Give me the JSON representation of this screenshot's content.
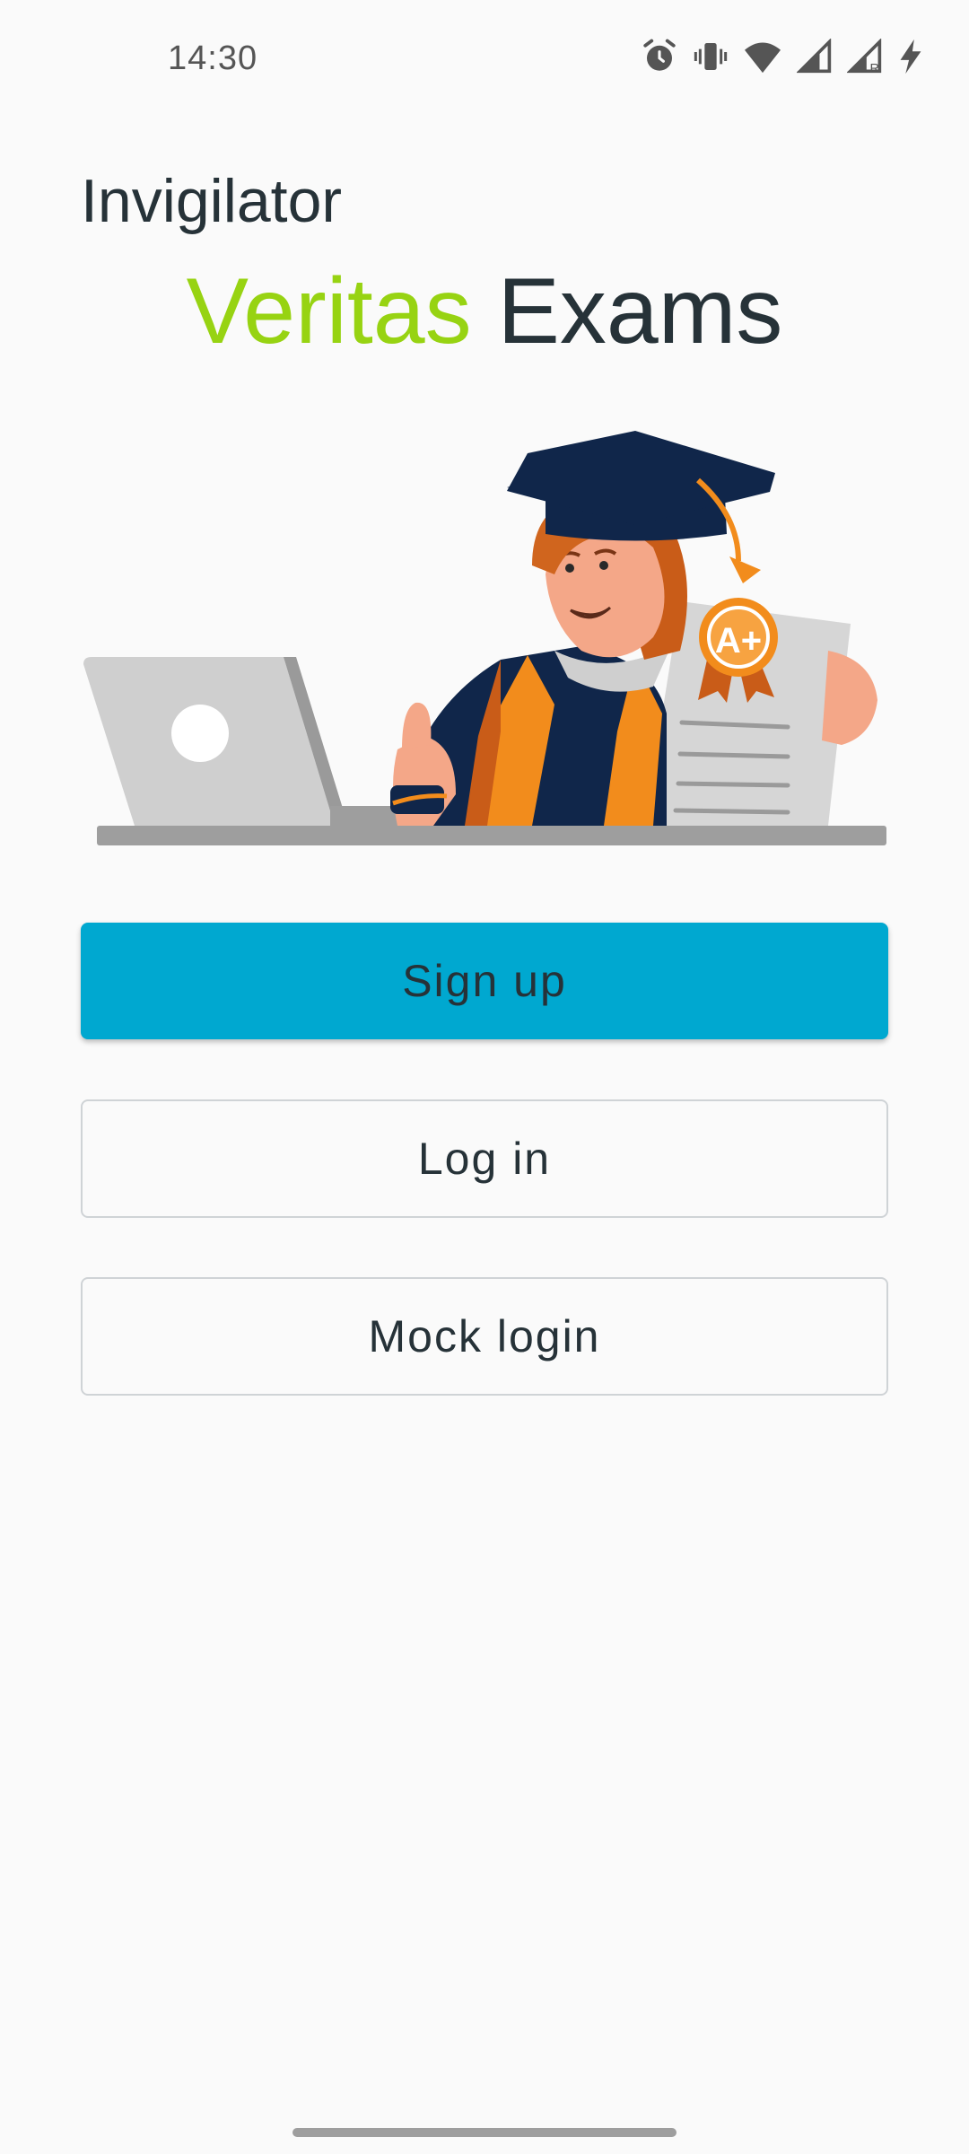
{
  "status_bar": {
    "time": "14:30",
    "icons": [
      "alarm-icon",
      "vibrate-icon",
      "wifi-icon",
      "signal-icon",
      "signal-roaming-icon",
      "charging-icon"
    ]
  },
  "header": {
    "role_label": "Invigilator",
    "brand_accent": "Veritas",
    "brand_rest": "Exams"
  },
  "hero": {
    "badge_text": "A+"
  },
  "actions": {
    "signup_label": "Sign up",
    "login_label": "Log in",
    "mock_login_label": "Mock login"
  },
  "colors": {
    "accent_green": "#97d312",
    "primary_button": "#00a8d0",
    "text_dark": "#263238"
  }
}
